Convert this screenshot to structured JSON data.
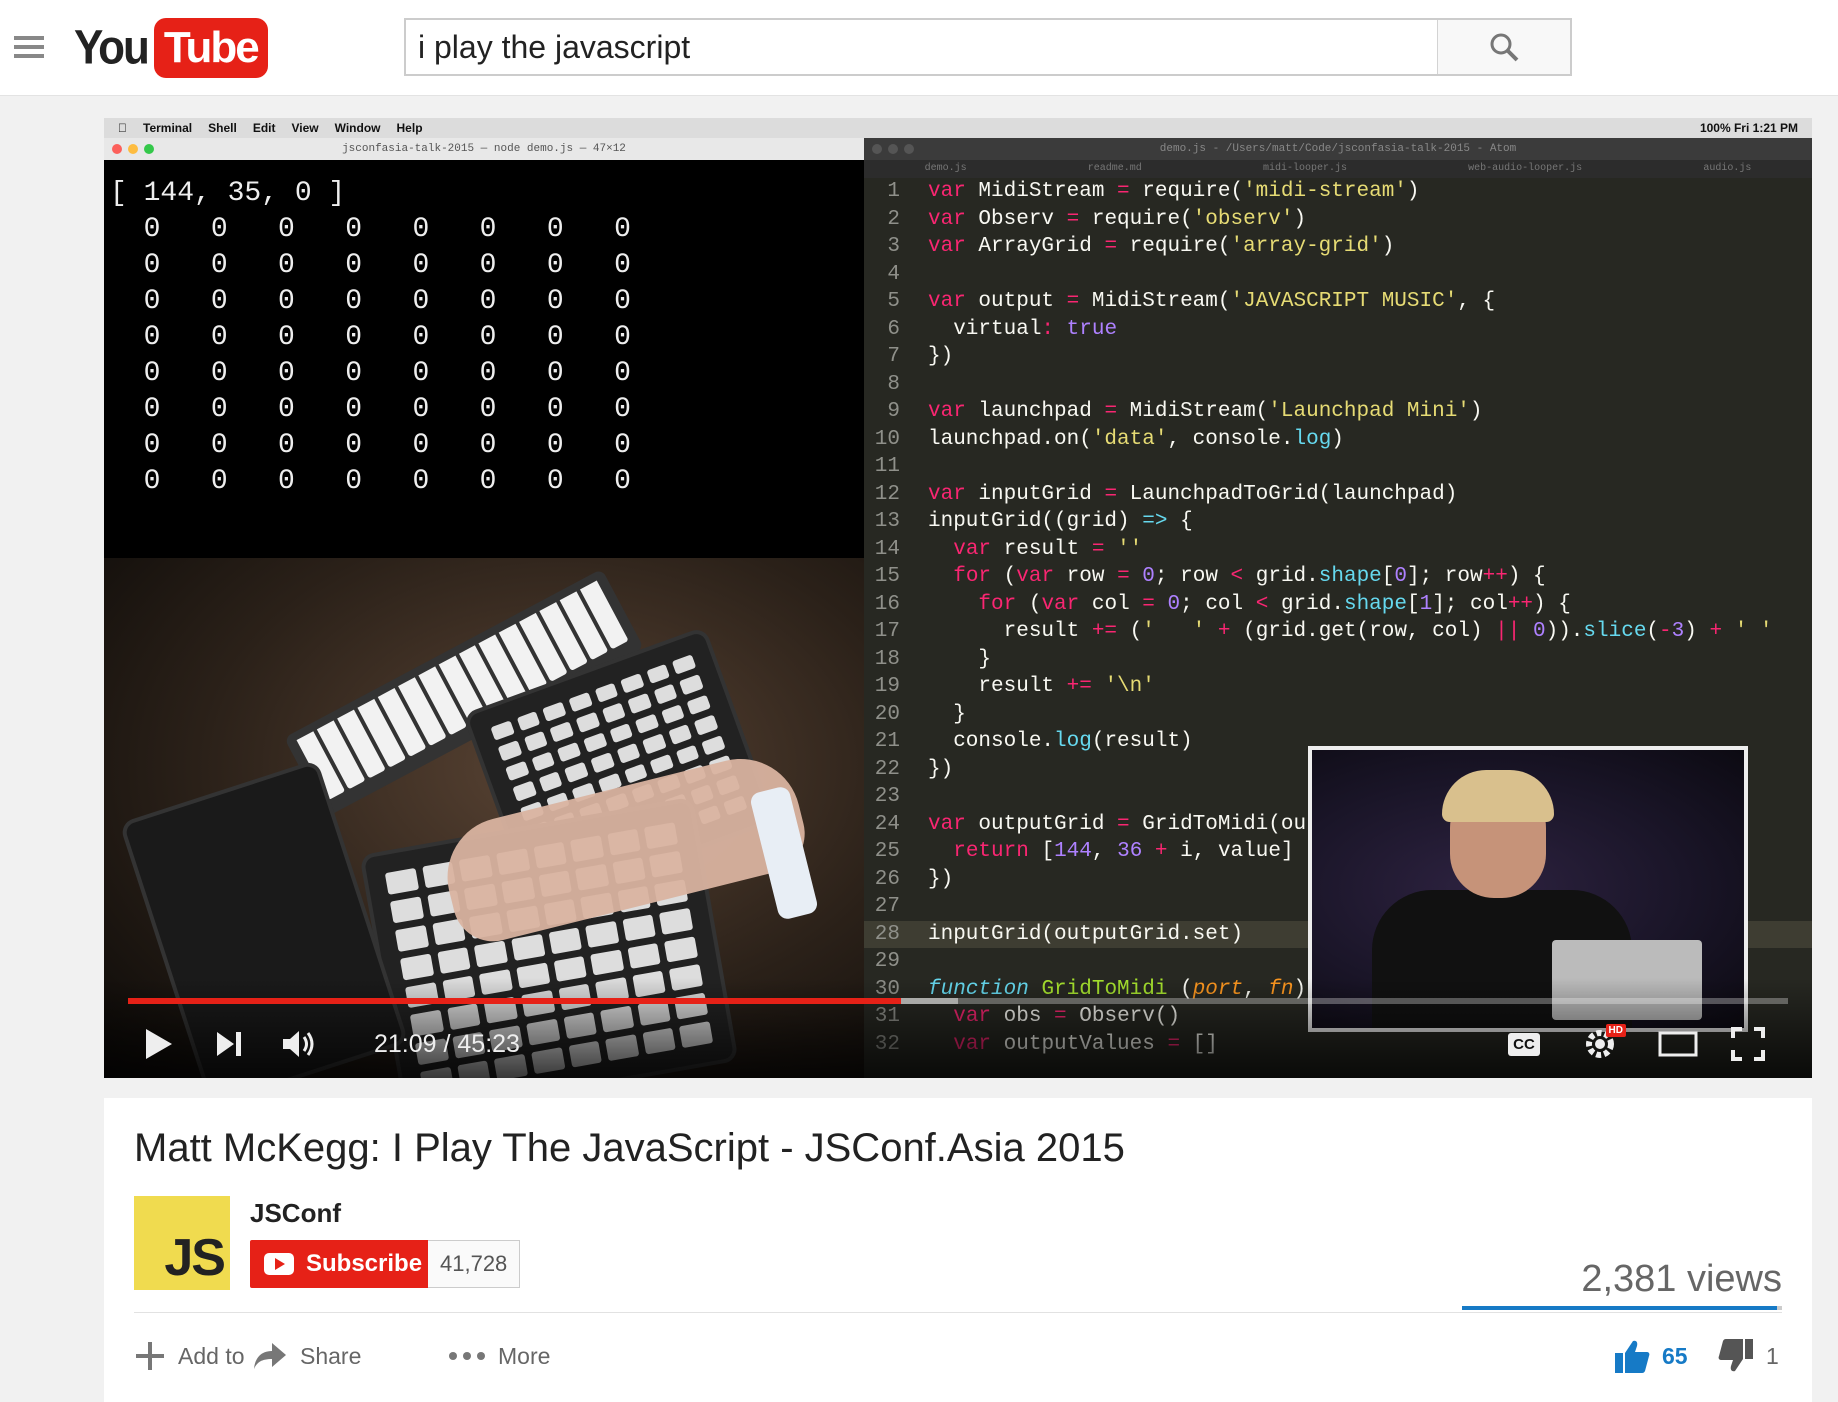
{
  "header": {
    "logo_you": "You",
    "logo_tube": "Tube",
    "search_value": "i play the javascript"
  },
  "video_frame": {
    "mac_menu": [
      "Terminal",
      "Shell",
      "Edit",
      "View",
      "Window",
      "Help"
    ],
    "mac_status": "100% Fri 1:21 PM",
    "terminal_title": "jsconfasia-talk-2015 — node demo.js — 47×12",
    "terminal_output": "[ 144, 35, 0 ]\n  0   0   0   0   0   0   0   0\n  0   0   0   0   0   0   0   0\n  0   0   0   0   0   0   0   0\n  0   0   0   0   0   0   0   0\n  0   0   0   0   0   0   0   0\n  0   0   0   0   0   0   0   0\n  0   0   0   0   0   0   0   0\n  0   0   0   0   0   0   0   0",
    "editor_title": "demo.js - /Users/matt/Code/jsconfasia-talk-2015 - Atom",
    "editor_tabs": [
      "demo.js",
      "readme.md",
      "midi-looper.js",
      "web-audio-looper.js",
      "audio.js"
    ],
    "code_lines": [
      "var MidiStream = require('midi-stream')",
      "var Observ = require('observ')",
      "var ArrayGrid = require('array-grid')",
      "",
      "var output = MidiStream('JAVASCRIPT MUSIC', {",
      "  virtual: true",
      "})",
      "",
      "var launchpad = MidiStream('Launchpad Mini')",
      "launchpad.on('data', console.log)",
      "",
      "var inputGrid = LaunchpadToGrid(launchpad)",
      "inputGrid((grid) => {",
      "  var result = ''",
      "  for (var row = 0; row < grid.shape[0]; row++) {",
      "    for (var col = 0; col < grid.shape[1]; col++) {",
      "      result += ('   ' + (grid.get(row, col) || 0)).slice(-3) + ' '",
      "    }",
      "    result += '\\n'",
      "  }",
      "  console.log(result)",
      "})",
      "",
      "var outputGrid = GridToMidi(outpu",
      "  return [144, 36 + i, value]",
      "})",
      "",
      "inputGrid(outputGrid.set)",
      "",
      "function GridToMidi (port, fn) {",
      "  var obs = Observ()",
      "  var outputValues = []"
    ],
    "current_line": 28
  },
  "player": {
    "time_display": "21:09 / 45:23",
    "played_fraction": 0.4658,
    "buffered_fraction": 0.5,
    "cc_label": "CC",
    "hd_badge": "HD"
  },
  "info": {
    "title": "Matt McKegg: I Play The JavaScript - JSConf.Asia 2015",
    "channel_name": "JSConf",
    "avatar_text": "JS",
    "subscribe_label": "Subscribe",
    "subscriber_count": "41,728",
    "views": "2,381 views",
    "like_fraction": 0.985,
    "actions": {
      "add_to": "Add to",
      "share": "Share",
      "more": "More"
    },
    "likes": "65",
    "dislikes": "1"
  },
  "colors": {
    "brand_red": "#e62117",
    "like_blue": "#167ac6"
  }
}
